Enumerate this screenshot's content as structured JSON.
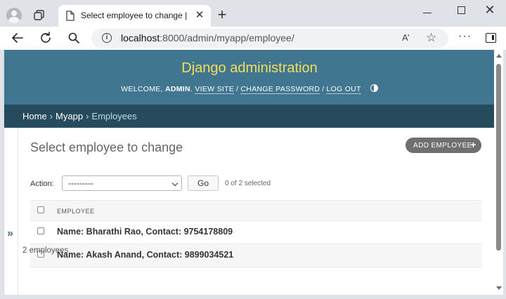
{
  "browser": {
    "tab_title": "Select employee to change | Django",
    "url_host": "localhost",
    "url_rest": ":8000/admin/myapp/employee/",
    "close_glyph": "✕",
    "newtab_glyph": "+",
    "winclose_glyph": "✕",
    "read_aloud_glyph": "A’",
    "favorite_glyph": "☆",
    "more_glyph": "···"
  },
  "header": {
    "site_name": "Django administration",
    "welcome": "WELCOME,",
    "username": "ADMIN",
    "view_site": "VIEW SITE",
    "change_password": "CHANGE PASSWORD",
    "log_out": "LOG OUT",
    "separator": "/"
  },
  "breadcrumbs": {
    "home": "Home",
    "app": "Myapp",
    "current": "Employees",
    "separator": "›"
  },
  "sidebar": {
    "toggle_glyph": "»"
  },
  "page": {
    "title": "Select employee to change",
    "add_button": "ADD EMPLOYEE",
    "add_glyph": "+"
  },
  "actions": {
    "label": "Action:",
    "selected_option": "---------",
    "go_label": "Go",
    "counter": "0 of 2 selected"
  },
  "table": {
    "column_header": "EMPLOYEE",
    "rows": [
      {
        "label": "Name: Bharathi Rao, Contact: 9754178809"
      },
      {
        "label": "Name: Akash Anand, Contact: 9899034521"
      }
    ]
  },
  "paginator": "2 employees",
  "colors": {
    "header_bg": "#417690",
    "title_yellow": "#f5dd5d",
    "breadcrumbs_bg": "#264b5d",
    "add_button_bg": "#6f6f6f"
  }
}
